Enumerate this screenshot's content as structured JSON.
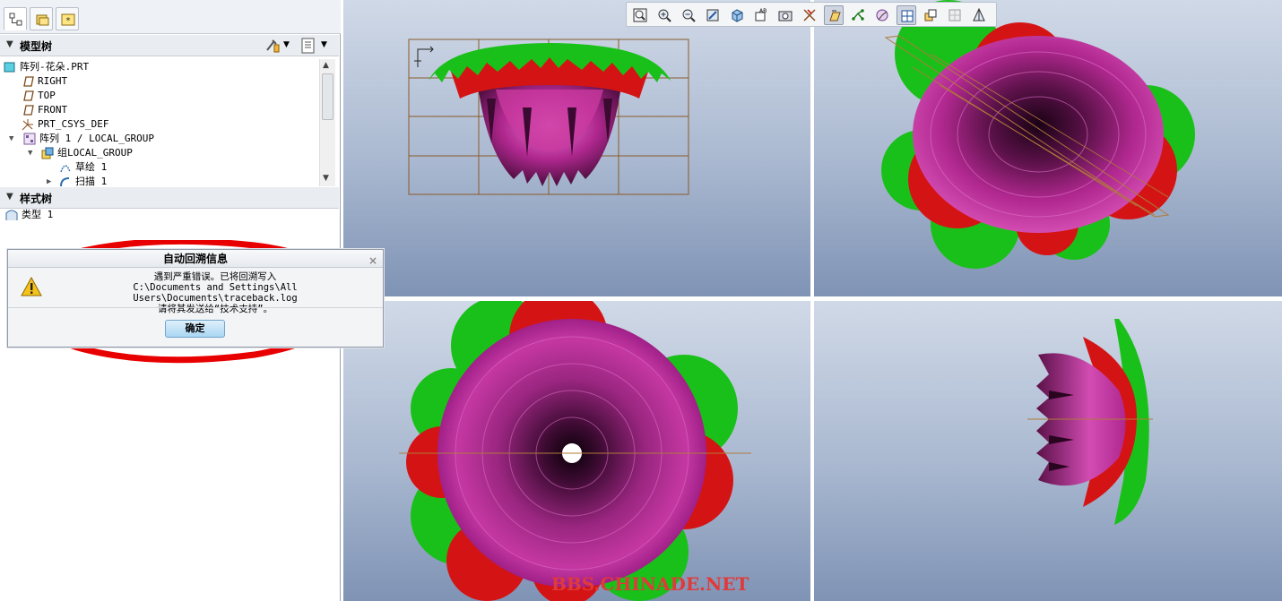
{
  "model_tree": {
    "header": "模型树",
    "items": [
      {
        "label": "阵列-花朵.PRT",
        "icon": "part-icon"
      },
      {
        "label": "RIGHT",
        "icon": "datum-plane-icon"
      },
      {
        "label": "TOP",
        "icon": "datum-plane-icon"
      },
      {
        "label": "FRONT",
        "icon": "datum-plane-icon"
      },
      {
        "label": "PRT_CSYS_DEF",
        "icon": "csys-icon"
      },
      {
        "label": "阵列 1 / LOCAL_GROUP",
        "icon": "pattern-icon"
      },
      {
        "label": "组LOCAL_GROUP",
        "icon": "group-icon"
      },
      {
        "label": "草绘 1",
        "icon": "sketch-icon"
      },
      {
        "label": "扫描 1",
        "icon": "sweep-icon"
      }
    ]
  },
  "style_tree": {
    "header": "样式树",
    "items": [
      {
        "label": "类型 1",
        "icon": "style-type-icon"
      }
    ]
  },
  "dialog": {
    "title": "自动回溯信息",
    "lines": [
      "遇到严重错误。已将回溯写入",
      "C:\\Documents and Settings\\All Users\\Documents\\traceback.log",
      "请将其发送给“技术支持”。"
    ],
    "ok_label": "确定",
    "close_glyph": "×"
  },
  "toolbar": {
    "buttons": [
      "zoom-fit-icon",
      "zoom-in-icon",
      "zoom-out-icon",
      "repaint-icon",
      "display-style-icon",
      "saved-views-icon",
      "view-manager-icon",
      "datum-display-icon",
      "plane-tag-icon",
      "point-display-icon",
      "csys-display-icon",
      "spin-center-icon",
      "annotation-display-icon",
      "layer-icon",
      "section-icon"
    ],
    "pressed": [
      "plane-tag-icon",
      "annotation-display-icon"
    ]
  },
  "watermark": "BBS.CHINADE.NET",
  "colors": {
    "petal_magenta": "#b0288f",
    "petal_dark": "#4a0d3d",
    "petal_red": "#e01313",
    "leaf_green": "#18c018",
    "viewport_top": "#d0d9e7",
    "viewport_bottom": "#7f93b5",
    "highlight_ellipse": "#e80000"
  }
}
